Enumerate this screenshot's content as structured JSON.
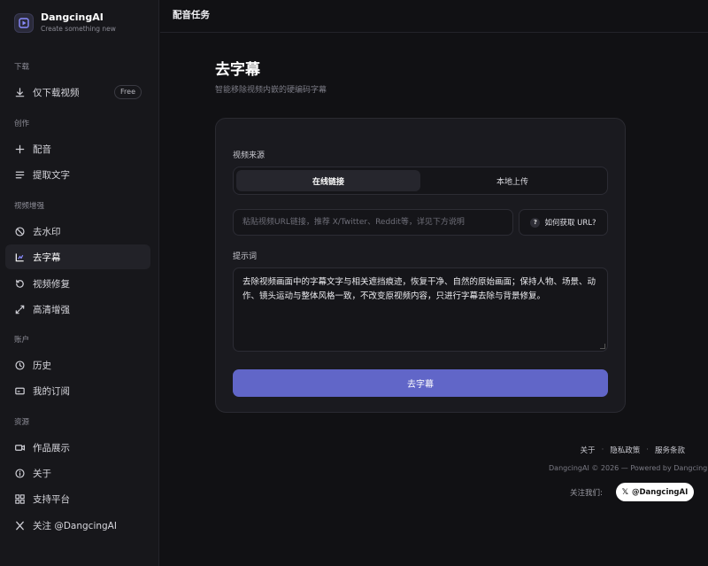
{
  "brand": {
    "name": "DangcingAI",
    "tagline": "Create something new"
  },
  "sidebar": {
    "sections": {
      "download": "下载",
      "create": "创作",
      "enhance": "视频增强",
      "account": "账户",
      "resources": "资源"
    },
    "items": {
      "download_only": "仅下载视频",
      "free_badge": "Free",
      "dubbing": "配音",
      "extract_text": "提取文字",
      "remove_watermark": "去水印",
      "remove_subtitles": "去字幕",
      "video_repair": "视频修复",
      "hd_enhance": "高清增强",
      "history": "历史",
      "subscriptions": "我的订阅",
      "showcase": "作品展示",
      "about": "关于",
      "support": "支持平台",
      "follow": "关注 @DangcingAI"
    }
  },
  "topbar": {
    "title": "配音任务"
  },
  "main": {
    "title": "去字幕",
    "subtitle": "智能移除视频内嵌的硬编码字幕",
    "source_label": "视频来源",
    "tab_online": "在线链接",
    "tab_local": "本地上传",
    "url_placeholder": "粘贴视频URL链接，推荐 X/Twitter、Reddit等，详见下方说明",
    "howto_label": "如何获取 URL?",
    "prompt_label": "提示词",
    "prompt_value": "去除视频画面中的字幕文字与相关遮挡痕迹，恢复干净、自然的原始画面；保持人物、场景、动作、镜头运动与整体风格一致，不改变原视频内容，只进行字幕去除与背景修复。",
    "submit_label": "去字幕"
  },
  "footer": {
    "about": "关于",
    "privacy": "隐私政策",
    "terms": "服务条款",
    "copyright": "DangcingAI © 2026 — Powered by Dangcing",
    "follow_label": "关注我们:",
    "follow_handle": "@DangcingAI"
  }
}
